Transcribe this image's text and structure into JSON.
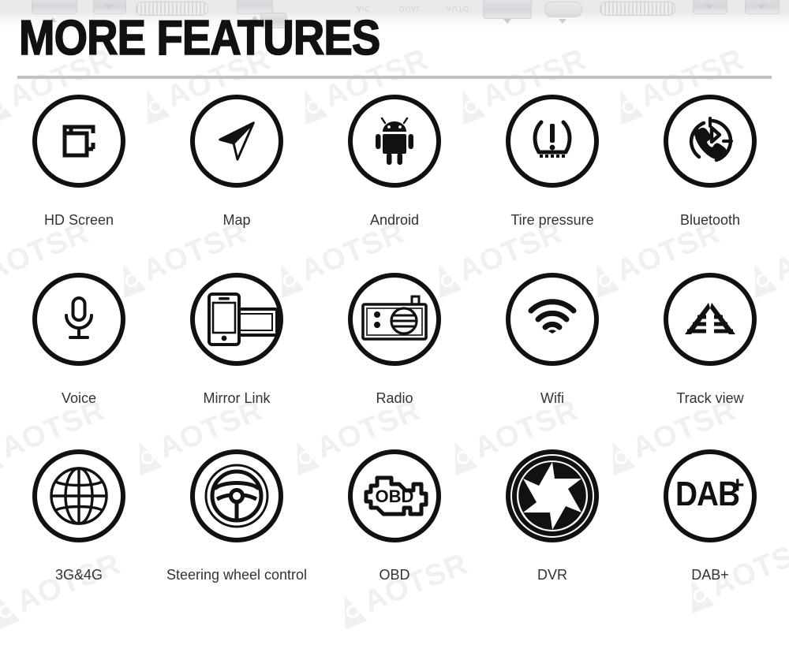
{
  "header": {
    "title": "MORE FEATURES",
    "banner_texts": [
      "A/C",
      "DUAL",
      "AUTO"
    ]
  },
  "watermark": {
    "text": "AOTSR",
    "color": "#f0f0f0"
  },
  "colors": {
    "title": "#111111",
    "divider": "#c2c2c2",
    "icon_stroke": "#111111",
    "label_text": "#333333",
    "background": "#ffffff"
  },
  "features": {
    "rows": [
      [
        {
          "label": "HD Screen",
          "icon": "hd-screen-icon"
        },
        {
          "label": "Map",
          "icon": "navigation-arrow-icon"
        },
        {
          "label": "Android",
          "icon": "android-robot-icon"
        },
        {
          "label": "Tire pressure",
          "icon": "tire-pressure-icon"
        },
        {
          "label": "Bluetooth",
          "icon": "bluetooth-phone-icon"
        }
      ],
      [
        {
          "label": "Voice",
          "icon": "microphone-icon"
        },
        {
          "label": "Mirror Link",
          "icon": "phone-monitor-icon"
        },
        {
          "label": "Radio",
          "icon": "radio-icon"
        },
        {
          "label": "Wifi",
          "icon": "wifi-icon"
        },
        {
          "label": "Track view",
          "icon": "parking-track-icon"
        }
      ],
      [
        {
          "label": "3G&4G",
          "icon": "globe-icon"
        },
        {
          "label": "Steering wheel control",
          "icon": "steering-wheel-icon"
        },
        {
          "label": "OBD",
          "icon": "obd-engine-icon"
        },
        {
          "label": "DVR",
          "icon": "camera-shutter-icon"
        },
        {
          "label": "DAB+",
          "icon": "dab-plus-icon"
        }
      ]
    ]
  }
}
